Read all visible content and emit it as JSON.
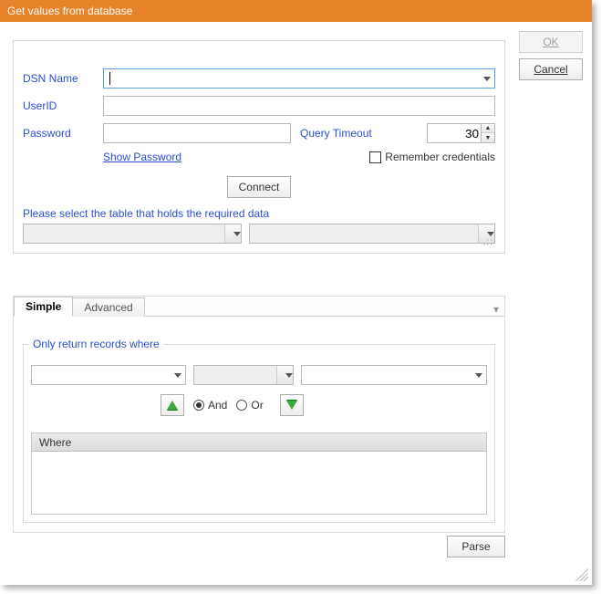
{
  "window": {
    "title": "Get values from database"
  },
  "buttons": {
    "ok": "OK",
    "cancel": "Cancel",
    "connect": "Connect",
    "parse": "Parse"
  },
  "form": {
    "dsn_label": "DSN Name",
    "dsn_value": "",
    "userid_label": "UserID",
    "userid_value": "",
    "password_label": "Password",
    "password_value": "",
    "query_timeout_label": "Query Timeout",
    "query_timeout_value": "30",
    "show_password": "Show Password",
    "remember_label": "Remember credentials",
    "select_table_label": "Please select the table that holds the required data"
  },
  "tabs": {
    "simple": "Simple",
    "advanced": "Advanced"
  },
  "filter": {
    "title": "Only return records where",
    "and_label": "And",
    "or_label": "Or",
    "grid_header": "Where"
  }
}
